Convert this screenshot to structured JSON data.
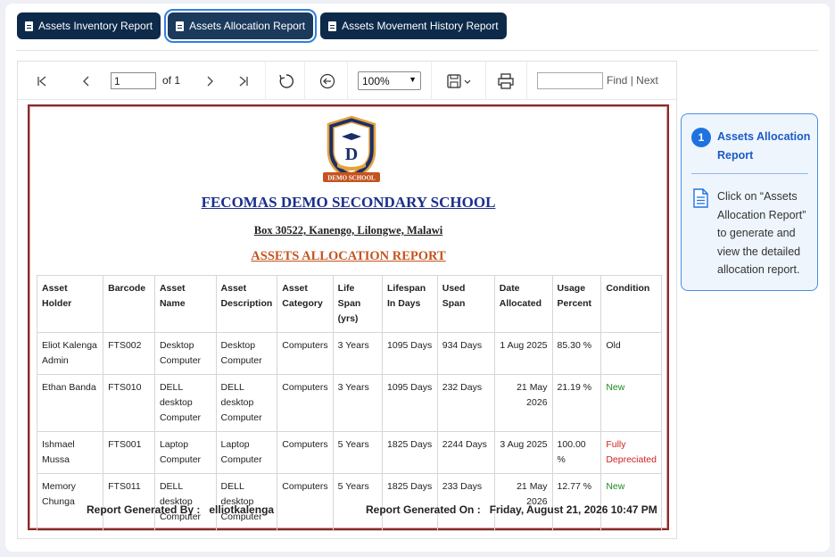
{
  "tabs": [
    {
      "label": "Assets Inventory Report",
      "active": false
    },
    {
      "label": "Assets Allocation Report",
      "active": true
    },
    {
      "label": "Assets Movement History Report",
      "active": false
    }
  ],
  "toolbar": {
    "page_value": "1",
    "page_total": "of 1",
    "zoom": "100%",
    "find_label": "Find",
    "link_sep": "|",
    "next_label": "Next",
    "icons": [
      "first-page-icon",
      "prev-page-icon",
      "next-page-icon",
      "last-page-icon",
      "refresh-icon",
      "back-icon",
      "save-icon",
      "print-icon"
    ]
  },
  "report": {
    "logo_text": "DEMO SCHOOL",
    "school_name": "FECOMAS DEMO SECONDARY SCHOOL",
    "address": "Box 30522, Kanengo, Lilongwe, Malawi",
    "title": "ASSETS ALLOCATION REPORT",
    "headers": [
      "Asset Holder",
      "Barcode",
      "Asset Name",
      "Asset Description",
      "Asset Category",
      "Life Span (yrs)",
      "Lifespan In Days",
      "Used Span",
      "Date Allocated",
      "Usage Percent",
      "Condition"
    ],
    "rows": [
      [
        "Eliot Kalenga Admin",
        "FTS002",
        "Desktop Computer",
        "Desktop Computer",
        "Computers",
        "3 Years",
        "1095  Days",
        "934 Days",
        "1 Aug 2025",
        "85.30 %",
        "Old"
      ],
      [
        "Ethan Banda",
        "FTS010",
        "DELL desktop Computer",
        "DELL desktop Computer",
        "Computers",
        "3 Years",
        "1095  Days",
        "232 Days",
        "21 May 2026",
        "21.19 %",
        "New"
      ],
      [
        "Ishmael Mussa",
        "FTS001",
        "Laptop Computer",
        "Laptop Computer",
        "Computers",
        "5 Years",
        "1825  Days",
        "2244 Days",
        "3 Aug 2025",
        "100.00 %",
        "Fully Depreciated"
      ],
      [
        "Memory Chunga",
        "FTS011",
        "DELL desktop Computer",
        "DELL desktop Computer",
        "Computers",
        "5 Years",
        "1825  Days",
        "233 Days",
        "21 May 2026",
        "12.77 %",
        "New"
      ]
    ],
    "generated_by_label": "Report Generated By :",
    "generated_by": "elliotkalenga",
    "generated_on_label": "Report Generated On :",
    "generated_on": "Friday, August 21, 2026 10:47 PM"
  },
  "callout": {
    "step": "1",
    "title": "Assets Allocation Report",
    "text": "Click on “Assets Allocation Report” to generate and view the detailed allocation report."
  },
  "colors": {
    "tab_bg": "#0d2a4a",
    "active_outline": "#2f7fe0",
    "report_border": "#8a2a2a",
    "school_name": "#1a2f8c",
    "report_title": "#c4531f",
    "condition_new": "#1f8a1f",
    "condition_depreciated": "#d12020",
    "callout_accent": "#1e73e0"
  }
}
